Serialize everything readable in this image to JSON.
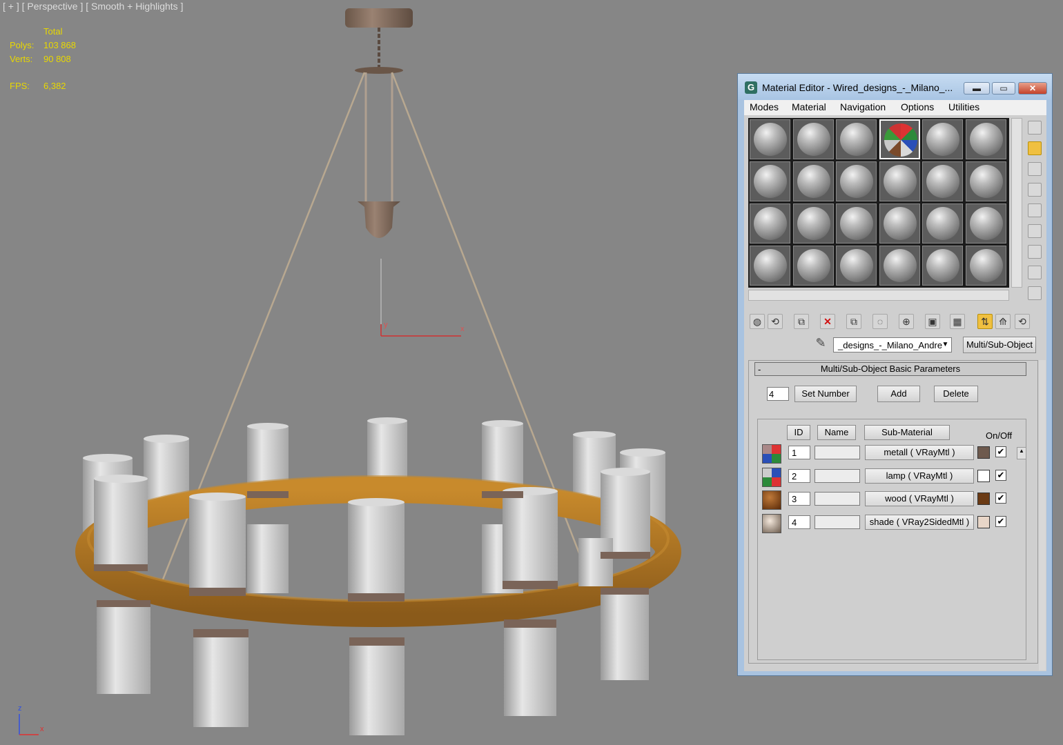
{
  "viewport": {
    "label": "[ + ] [ Perspective ] [ Smooth + Highlights ]",
    "stats": {
      "total_label": "Total",
      "polys_label": "Polys:",
      "polys_value": "103 868",
      "verts_label": "Verts:",
      "verts_value": "90 808",
      "fps_label": "FPS:",
      "fps_value": "6,382"
    },
    "gizmo": {
      "axis_y": "y",
      "axis_x": "x",
      "axis_z": "z"
    },
    "world_axis": {
      "z": "z",
      "x": "x"
    }
  },
  "material_editor": {
    "title": "Material Editor - Wired_designs_-_Milano_...",
    "title_icon": "G",
    "menu": [
      "Modes",
      "Material",
      "Navigation",
      "Options",
      "Utilities"
    ],
    "slot_count": 24,
    "active_slot": 3,
    "material_name": "_designs_-_Milano_Andre",
    "material_type": "Multi/Sub-Object",
    "rollout_title": "Multi/Sub-Object Basic Parameters",
    "rollout_toggle": "-",
    "number_of_submaterials": "4",
    "set_number_label": "Set Number",
    "add_label": "Add",
    "delete_label": "Delete",
    "headers": {
      "id": "ID",
      "name": "Name",
      "sub_material": "Sub-Material",
      "on_off": "On/Off"
    },
    "submaterials": [
      {
        "id": "1",
        "name": "",
        "label": "metall  ( VRayMtl )",
        "color": "#6e5a4e",
        "enabled": true
      },
      {
        "id": "2",
        "name": "",
        "label": "lamp  ( VRayMtl )",
        "color": "#ffffff",
        "enabled": true
      },
      {
        "id": "3",
        "name": "",
        "label": "wood  ( VRayMtl )",
        "color": "#6a3a14",
        "enabled": true
      },
      {
        "id": "4",
        "name": "",
        "label": "shade  ( VRay2SidedMtl )",
        "color": "#e8d6c8",
        "enabled": true
      }
    ]
  },
  "colors": {
    "viewport_bg": "#868686",
    "stat_text": "#e8d800",
    "window_frame": "#a9c3e0",
    "highlight_tool": "#f0c040"
  }
}
